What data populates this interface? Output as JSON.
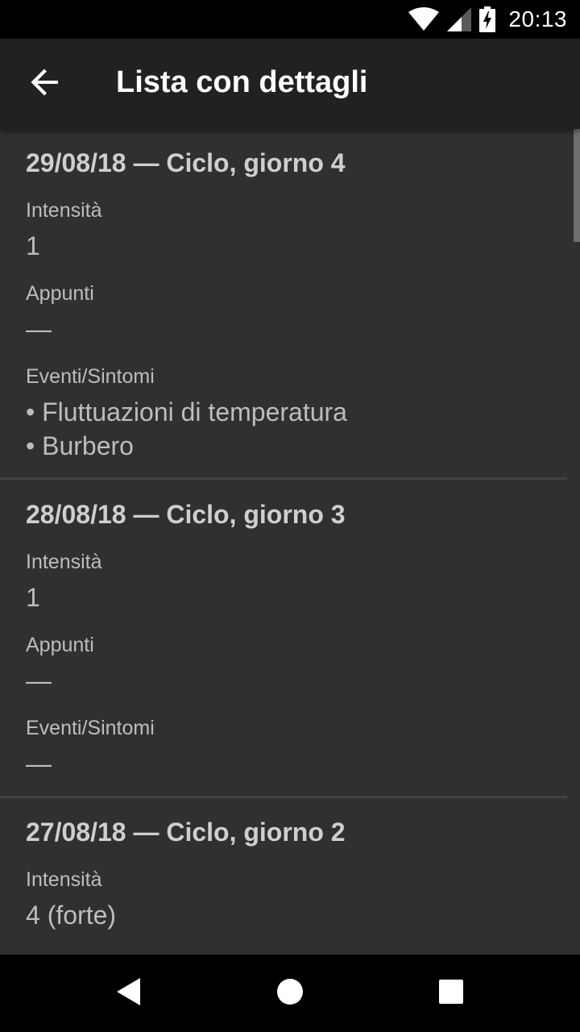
{
  "status_bar": {
    "time": "20:13",
    "icons": [
      "wifi-icon",
      "cellular-signal-icon",
      "battery-charging-icon"
    ]
  },
  "app_bar": {
    "title": "Lista con dettagli",
    "back_icon": "arrow-back-icon"
  },
  "entries": [
    {
      "title": "29/08/18 — Ciclo, giorno 4",
      "intensity_label": "Intensità",
      "intensity_value": "1",
      "notes_label": "Appunti",
      "notes_value": "—",
      "events_label": "Eventi/Sintomi",
      "events": [
        "• Fluttuazioni di temperatura",
        "• Burbero"
      ]
    },
    {
      "title": "28/08/18 — Ciclo, giorno 3",
      "intensity_label": "Intensità",
      "intensity_value": "1",
      "notes_label": "Appunti",
      "notes_value": "—",
      "events_label": "Eventi/Sintomi",
      "events": [
        "—"
      ]
    },
    {
      "title": "27/08/18 — Ciclo, giorno 2",
      "intensity_label": "Intensità",
      "intensity_value": "4 (forte)"
    }
  ],
  "nav_bar": {
    "icons": [
      "back-triangle-icon",
      "home-circle-icon",
      "recents-square-icon"
    ]
  },
  "colors": {
    "background": "#303030",
    "app_bar": "#212121",
    "status_bar": "#000000",
    "text_primary": "#cfcfcf",
    "text_secondary": "#bdbdbd",
    "divider": "#424242"
  }
}
